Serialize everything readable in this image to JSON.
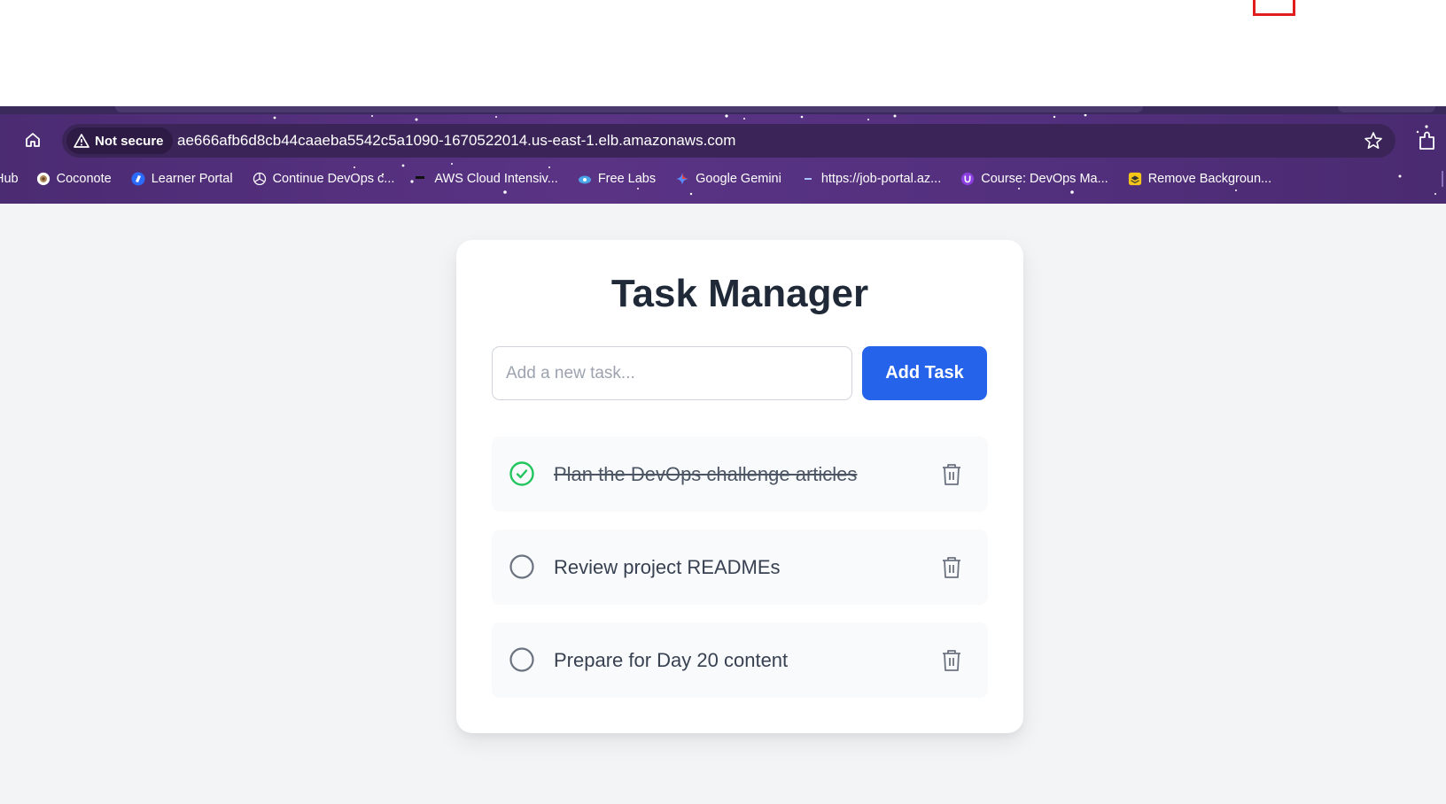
{
  "browser": {
    "security_label": "Not secure",
    "url": "ae666afb6d8cb44caaeba5542c5a1090-1670522014.us-east-1.elb.amazonaws.com",
    "bookmarks": [
      {
        "label": "Hub",
        "icon": "hub-icon"
      },
      {
        "label": "Coconote",
        "icon": "coconote-icon"
      },
      {
        "label": "Learner Portal",
        "icon": "learner-portal-icon"
      },
      {
        "label": "Continue DevOps c...",
        "icon": "chatgpt-icon"
      },
      {
        "label": "AWS Cloud Intensiv...",
        "icon": "aws-icon"
      },
      {
        "label": "Free Labs",
        "icon": "free-labs-icon"
      },
      {
        "label": "Google Gemini",
        "icon": "gemini-icon"
      },
      {
        "label": "https://job-portal.az...",
        "icon": "link-icon"
      },
      {
        "label": "Course: DevOps Ma...",
        "icon": "course-icon"
      },
      {
        "label": "Remove Backgroun...",
        "icon": "remove-bg-icon"
      }
    ]
  },
  "app": {
    "title": "Task Manager",
    "input": {
      "placeholder": "Add a new task...",
      "value": ""
    },
    "add_button_label": "Add Task",
    "tasks": [
      {
        "text": "Plan the DevOps challenge articles",
        "completed": true
      },
      {
        "text": "Review project READMEs",
        "completed": false
      },
      {
        "text": "Prepare for Day 20 content",
        "completed": false
      }
    ]
  },
  "colors": {
    "accent": "#2563eb",
    "completed_check": "#22c55e",
    "browser_frame": "#4b2b72"
  }
}
